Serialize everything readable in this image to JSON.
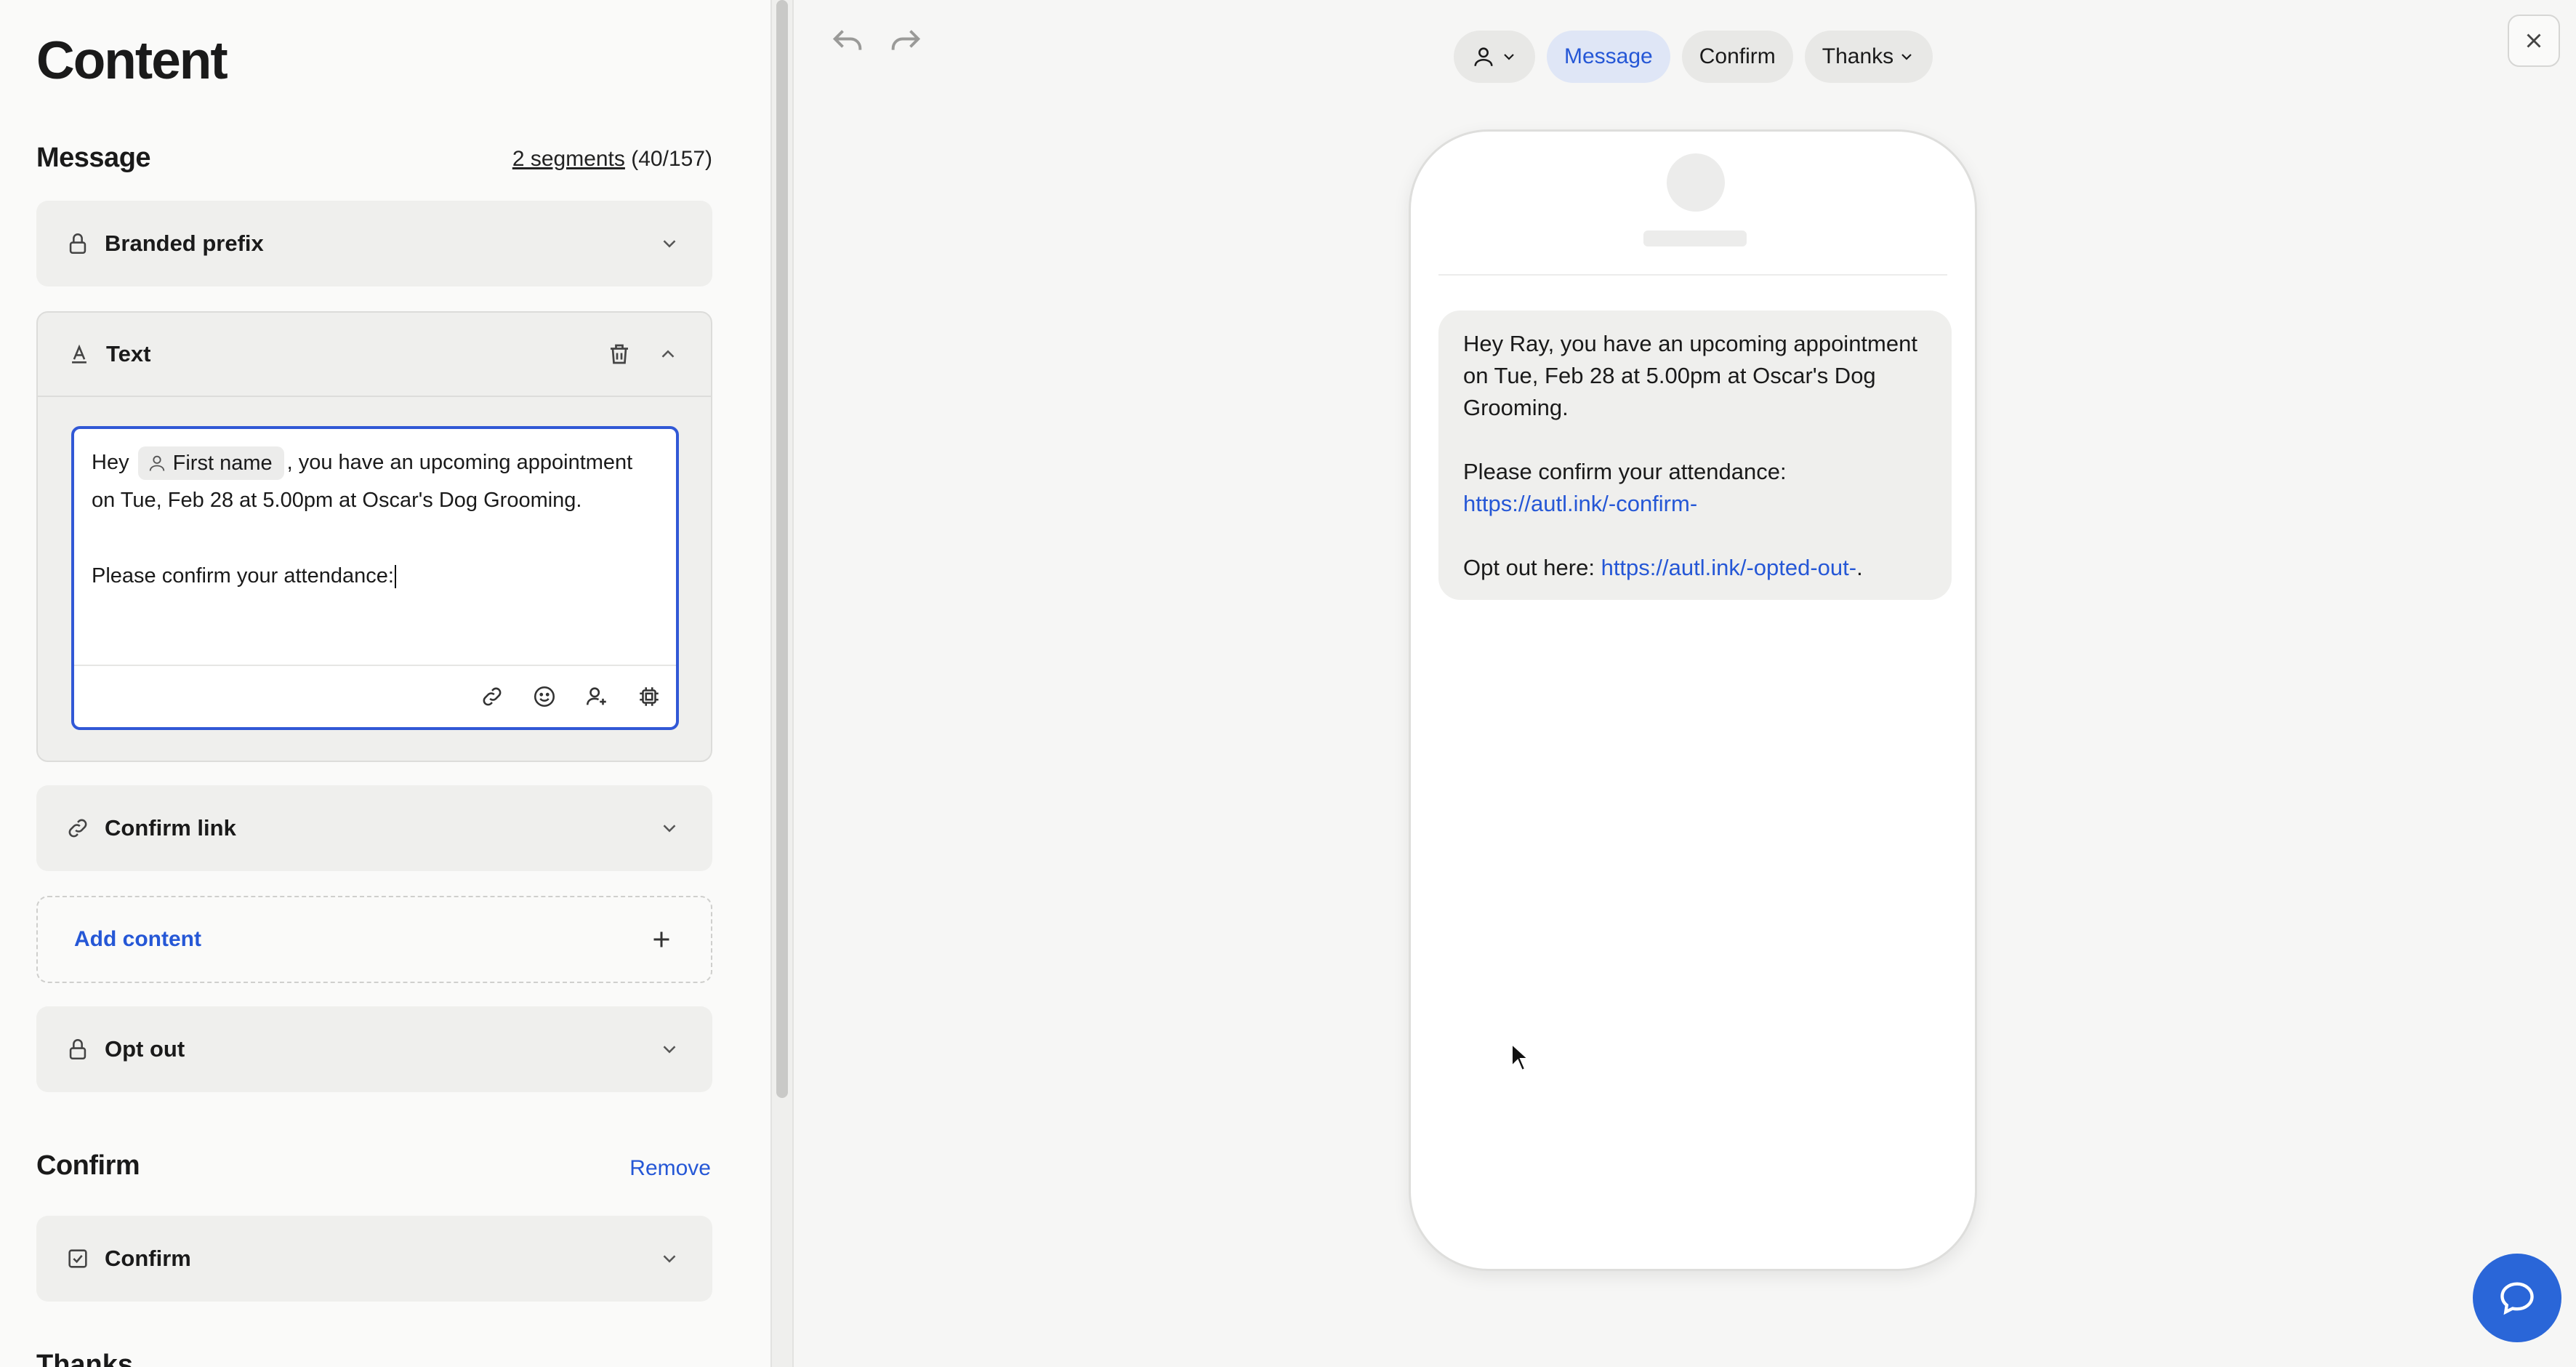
{
  "panel": {
    "title": "Content"
  },
  "message_section": {
    "title": "Message",
    "segments_link": "2 segments",
    "segments_count": "(40/157)"
  },
  "cards": {
    "branded_prefix": "Branded prefix",
    "text": "Text",
    "confirm_link": "Confirm link",
    "add_content": "Add content",
    "opt_out": "Opt out",
    "confirm_card": "Confirm"
  },
  "editor": {
    "prefix": "Hey",
    "chip_label": "First name",
    "line1_suffix": ", you have an upcoming appointment",
    "line2": "on Tue, Feb 28 at 5.00pm at Oscar's Dog Grooming.",
    "line3": "Please confirm your attendance:"
  },
  "confirm_section": {
    "title": "Confirm",
    "remove": "Remove"
  },
  "next_section_title": "Thanks",
  "preview_tabs": {
    "message": "Message",
    "confirm": "Confirm",
    "thanks": "Thanks"
  },
  "preview_message": {
    "para1": "Hey Ray, you have an upcoming appointment on Tue, Feb 28 at 5.00pm at Oscar's Dog Grooming.",
    "confirm_prefix": "Please confirm your attendance:",
    "confirm_url": "https://autl.ink/-confirm-",
    "optout_prefix": "Opt out here:",
    "optout_url": "https://autl.ink/-opted-out-",
    "optout_suffix": "."
  },
  "icons": {
    "lock": "lock-icon",
    "text": "text-format-icon",
    "trash": "trash-icon",
    "link": "link-icon",
    "emoji": "emoji-icon",
    "add_person": "add-person-icon",
    "chip": "chip-icon",
    "plus": "plus-icon",
    "checkbox": "checkbox-icon",
    "undo": "undo-icon",
    "redo": "redo-icon",
    "close": "close-icon",
    "help": "chat-bubble-icon"
  },
  "colors": {
    "accent": "#2557d6",
    "help_button": "#2a66d8",
    "card_bg": "#efefed"
  }
}
